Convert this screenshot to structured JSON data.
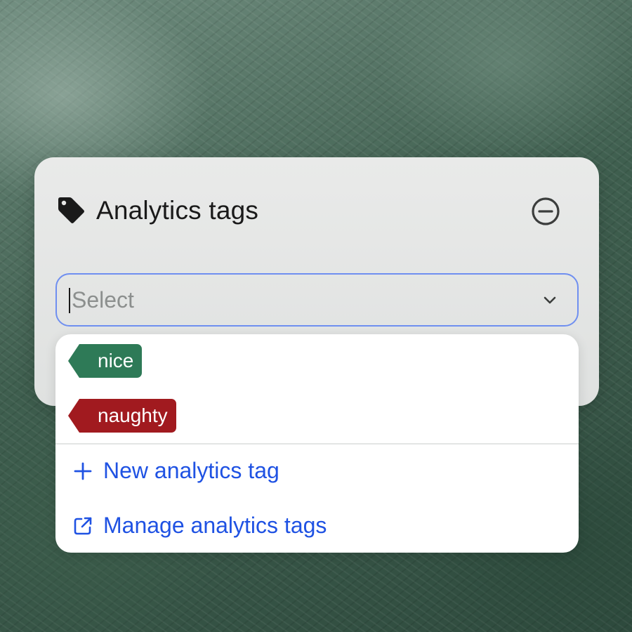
{
  "card": {
    "title": "Analytics tags",
    "icon": "tag-icon",
    "remove_icon": "minus-circle-icon"
  },
  "select": {
    "placeholder": "Select",
    "icon": "chevron-down-icon"
  },
  "dropdown": {
    "tags": [
      {
        "label": "nice",
        "color": "#2e7a57"
      },
      {
        "label": "naughty",
        "color": "#a11a1f"
      }
    ],
    "actions": [
      {
        "label": "New analytics tag",
        "icon": "plus-icon"
      },
      {
        "label": "Manage analytics tags",
        "icon": "external-link-icon"
      }
    ]
  },
  "colors": {
    "accent": "#1f52e3",
    "focus_border": "#6f8ff0"
  }
}
